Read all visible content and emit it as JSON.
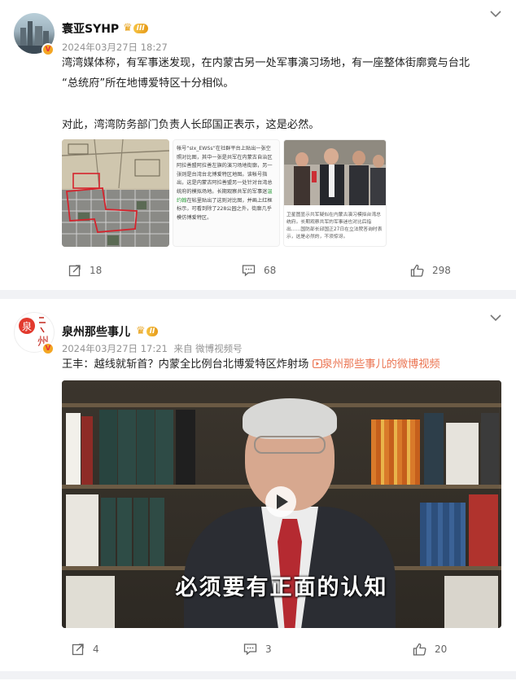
{
  "post1": {
    "author": "寰亚SYHP",
    "level_tag": "III",
    "timestamp": "2024年03月27日 18:27",
    "text_line1": "湾湾媒体称，有军事迷发现，在内蒙古另一处军事演习场地，有一座整体街廓竟与台北",
    "text_line2": "“总统府”所在地博爱特区十分相似。",
    "text_line3": "对此，湾湾防务部门负责人长邱国正表示，这是必然。",
    "doc_text": "帐号“sIx_EWSs”在社群平台上贴出一张空照对比图，其中一张是共军在内蒙古自治区阿拉善盟阿拉善左旗的演习场地街廓，另一张则是台湾台北博爱特区地图。该帐号指出，这是内蒙古阿拉善盟另一处针对台湾总统府的模拟场地。长期观察共军的军事迷",
    "doc_highlight": "温约翰",
    "doc_text2": "在帖里贴出了这则对比图，并画上红框标示，可看到除了228公园之外，街廓几乎模仿博爱特区。",
    "photo_caption": "卫星图显示共军疑似在内蒙古演习模拟台湾总统府。长期观察共军的军事迷也对比后指出……国防部长邱国正27日在立法院答询时表示，这是必然的，不须惊讶。",
    "repost_count": "18",
    "comment_count": "68",
    "like_count": "298"
  },
  "post2": {
    "author": "泉州那些事儿",
    "level_tag": "II",
    "timestamp": "2024年03月27日 17:21",
    "source": "来自 微博视频号",
    "text": "王丰：越线就斩首？内蒙全比例台北博爱特区炸射场",
    "video_link": "泉州那些事儿的微博视频",
    "video_subtitle": "必须要有正面的认知",
    "repost_count": "4",
    "comment_count": "3",
    "like_count": "20"
  },
  "colors": {
    "link": "#eb7350",
    "badge": "#f3a623",
    "level_tag": "#e69a18"
  }
}
